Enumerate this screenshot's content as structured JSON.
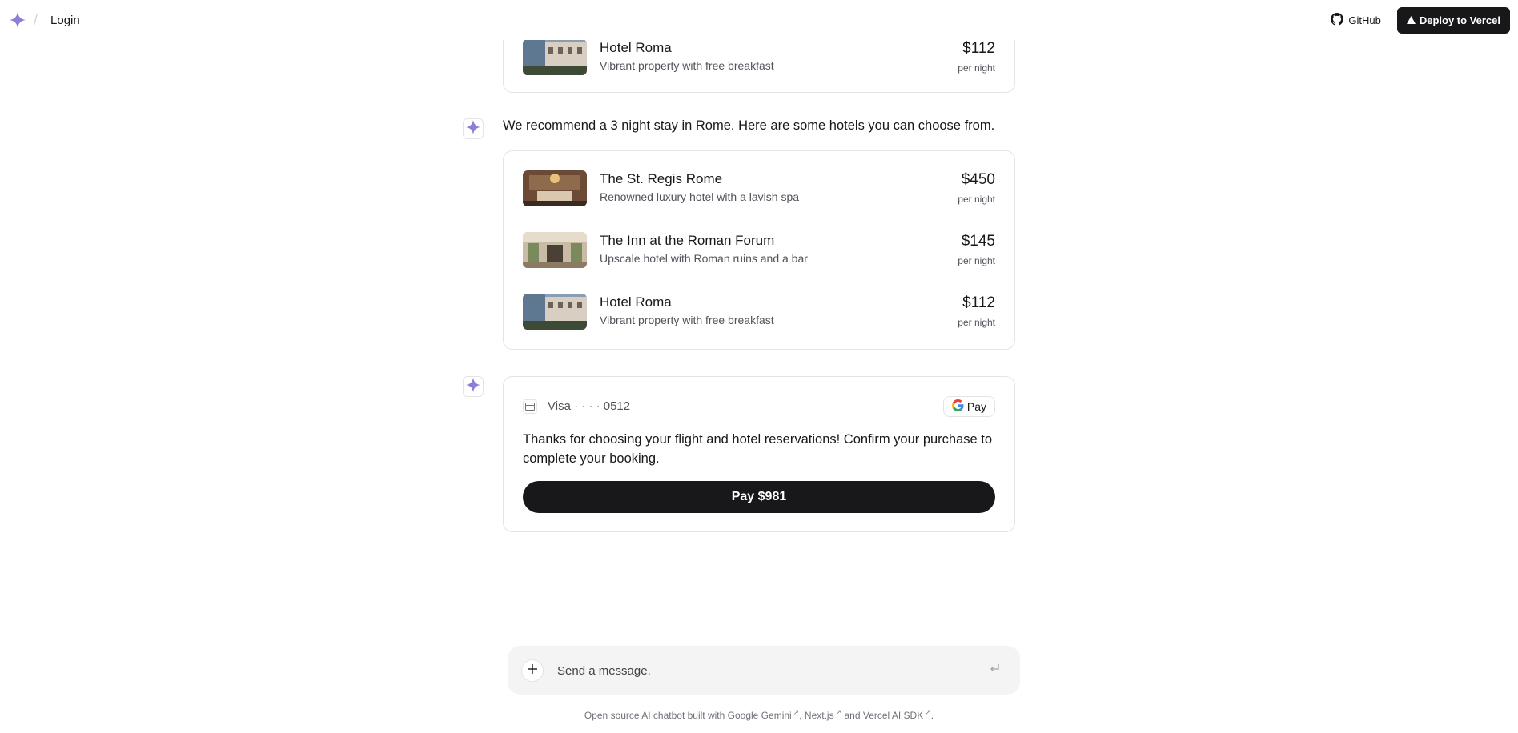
{
  "header": {
    "login_label": "Login",
    "github_label": "GitHub",
    "deploy_label": "Deploy to Vercel",
    "brand_color": "#8b7fd8"
  },
  "prev_card": {
    "hotel": {
      "name": "Hotel Roma",
      "description": "Vibrant property with free breakfast",
      "price": "$112",
      "unit": "per night"
    }
  },
  "recommendation": {
    "text": "We recommend a 3 night stay in Rome. Here are some hotels you can choose from.",
    "hotels": [
      {
        "name": "The St. Regis Rome",
        "description": "Renowned luxury hotel with a lavish spa",
        "price": "$450",
        "unit": "per night"
      },
      {
        "name": "The Inn at the Roman Forum",
        "description": "Upscale hotel with Roman ruins and a bar",
        "price": "$145",
        "unit": "per night"
      },
      {
        "name": "Hotel Roma",
        "description": "Vibrant property with free breakfast",
        "price": "$112",
        "unit": "per night"
      }
    ]
  },
  "payment": {
    "card_label": "Visa · · · · 0512",
    "gpay_label": "Pay",
    "message": "Thanks for choosing your flight and hotel reservations! Confirm your purchase to complete your booking.",
    "pay_button": "Pay $981"
  },
  "composer": {
    "placeholder": "Send a message.",
    "value": ""
  },
  "footer": {
    "prefix": "Open source AI chatbot built with ",
    "link1": "Google Gemini",
    "sep1": ", ",
    "link2": "Next.js",
    "sep2": " and ",
    "link3": "Vercel AI SDK",
    "suffix": "."
  }
}
